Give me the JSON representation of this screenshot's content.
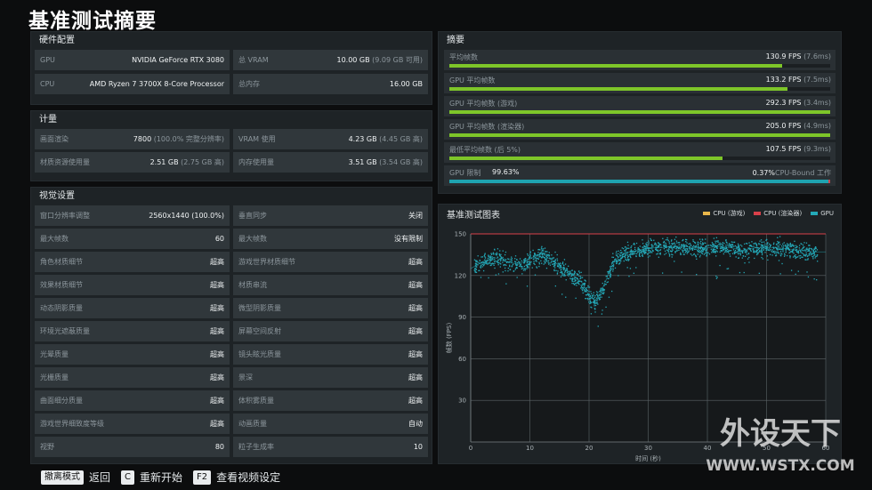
{
  "title": "基准测试摘要",
  "hardware": {
    "header": "硬件配置",
    "rows": [
      [
        {
          "label": "GPU",
          "value": "NVIDIA GeForce RTX 3080",
          "sub": ""
        },
        {
          "label": "总 VRAM",
          "value": "10.00 GB",
          "sub": "(9.09 GB 可用)"
        }
      ],
      [
        {
          "label": "CPU",
          "value": "AMD Ryzen 7 3700X 8-Core Processor",
          "sub": ""
        },
        {
          "label": "总内存",
          "value": "16.00 GB",
          "sub": ""
        }
      ]
    ]
  },
  "metrics": {
    "header": "计量",
    "rows": [
      [
        {
          "label": "画面渲染",
          "value": "7800",
          "sub": "(100.0% 完整分辨率)"
        },
        {
          "label": "VRAM 使用",
          "value": "4.23 GB",
          "sub": "(4.45 GB 高)"
        }
      ],
      [
        {
          "label": "材质资源使用量",
          "value": "2.51 GB",
          "sub": "(2.75 GB 高)"
        },
        {
          "label": "内存使用量",
          "value": "3.51 GB",
          "sub": "(3.54 GB 高)"
        }
      ]
    ]
  },
  "visual": {
    "header": "视觉设置",
    "rows": [
      [
        {
          "label": "窗口分辨率调整",
          "value": "2560x1440 (100.0%)"
        },
        {
          "label": "垂直同步",
          "value": "关闭"
        }
      ],
      [
        {
          "label": "最大帧数",
          "value": "60"
        },
        {
          "label": "最大帧数",
          "value": "没有限制"
        }
      ],
      [
        {
          "label": "角色材质细节",
          "value": "超高"
        },
        {
          "label": "游戏世界材质细节",
          "value": "超高"
        }
      ],
      [
        {
          "label": "效果材质细节",
          "value": "超高"
        },
        {
          "label": "材质串流",
          "value": "超高"
        }
      ],
      [
        {
          "label": "动态阴影质量",
          "value": "超高"
        },
        {
          "label": "微型阴影质量",
          "value": "超高"
        }
      ],
      [
        {
          "label": "环境光遮蔽质量",
          "value": "超高"
        },
        {
          "label": "屏幕空间反射",
          "value": "超高"
        }
      ],
      [
        {
          "label": "光晕质量",
          "value": "超高"
        },
        {
          "label": "镜头眩光质量",
          "value": "超高"
        }
      ],
      [
        {
          "label": "光栅质量",
          "value": "超高"
        },
        {
          "label": "景深",
          "value": "超高"
        }
      ],
      [
        {
          "label": "曲面细分质量",
          "value": "超高"
        },
        {
          "label": "体积雾质量",
          "value": "超高"
        }
      ],
      [
        {
          "label": "游戏世界细致度等级",
          "value": "超高"
        },
        {
          "label": "动画质量",
          "value": "自动"
        }
      ],
      [
        {
          "label": "视野",
          "value": "80"
        },
        {
          "label": "粒子生成率",
          "value": "10"
        }
      ]
    ]
  },
  "summary": {
    "header": "摘要",
    "rows": [
      {
        "label": "平均帧数",
        "value": "130.9 FPS",
        "sub": "(7.6ms)",
        "fill": 0.873
      },
      {
        "label": "GPU 平均帧数",
        "value": "133.2 FPS",
        "sub": "(7.5ms)",
        "fill": 0.888
      },
      {
        "label": "GPU 平均帧数 (游戏)",
        "value": "292.3 FPS",
        "sub": "(3.4ms)",
        "fill": 1.0
      },
      {
        "label": "GPU 平均帧数 (渲染器)",
        "value": "205.0 FPS",
        "sub": "(4.9ms)",
        "fill": 1.0
      },
      {
        "label": "最低平均帧数 (后 5%)",
        "value": "107.5 FPS",
        "sub": "(9.3ms)",
        "fill": 0.717
      }
    ],
    "gpu_limit": {
      "label": "GPU 限制",
      "gpu_pct": "99.63%",
      "cpu_pct": "0.37%",
      "cpu_label": "CPU-Bound 工作",
      "gpu_fraction": 0.9963
    }
  },
  "chart": {
    "header": "基准测试图表",
    "legend": [
      {
        "name": "CPU (游戏)",
        "color": "#e8b64a"
      },
      {
        "name": "CPU (渲染器)",
        "color": "#d8404a"
      },
      {
        "name": "GPU",
        "color": "#24a9b8"
      }
    ]
  },
  "chart_data": {
    "type": "scatter",
    "title": "基准测试图表",
    "xlabel": "时间 (秒)",
    "ylabel": "帧数 (FPS)",
    "xlim": [
      0,
      60
    ],
    "ylim": [
      0,
      150
    ],
    "xticks": [
      0,
      10,
      20,
      30,
      40,
      50,
      60
    ],
    "yticks": [
      30,
      60,
      90,
      120,
      150
    ],
    "grid": true,
    "legend_position": "top-right",
    "series": [
      {
        "name": "CPU (渲染器)",
        "color": "#d8404a",
        "x": [
          0,
          60
        ],
        "y": [
          150,
          150
        ]
      },
      {
        "name": "GPU",
        "color": "#24a9b8",
        "x": [
          0,
          2,
          4,
          6,
          8,
          10,
          12,
          14,
          16,
          18,
          19,
          20,
          21,
          22,
          23,
          24,
          26,
          28,
          30,
          32,
          34,
          36,
          38,
          40,
          42,
          44,
          46,
          48,
          50,
          52,
          54,
          56,
          58,
          60
        ],
        "y": [
          125,
          130,
          133,
          130,
          128,
          132,
          136,
          130,
          124,
          118,
          114,
          105,
          102,
          108,
          118,
          130,
          136,
          138,
          140,
          140,
          141,
          141,
          140,
          140,
          141,
          140,
          138,
          140,
          140,
          140,
          139,
          138,
          137,
          137
        ]
      }
    ]
  },
  "footer": {
    "items": [
      {
        "key": "撤离模式",
        "action": "返回"
      },
      {
        "key": "C",
        "action": "重新开始"
      },
      {
        "key": "F2",
        "action": "查看视频设定"
      }
    ]
  },
  "watermark": {
    "line1": "外设天下",
    "line2": "WWW.WSTX.COM"
  }
}
